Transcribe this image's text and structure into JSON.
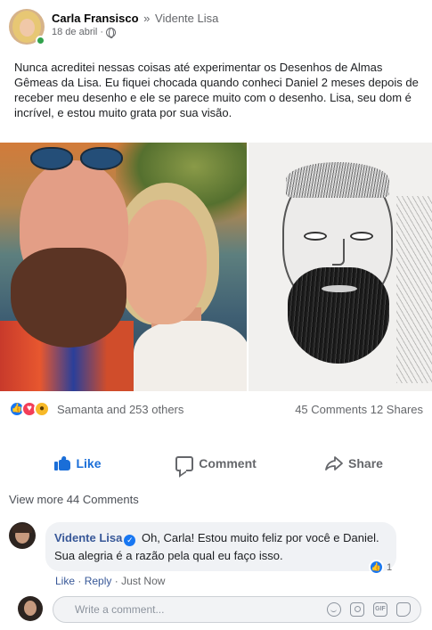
{
  "post": {
    "author": "Carla Fransisco",
    "arrow": "»",
    "page": "Vidente Lisa",
    "date": "18 de abril",
    "date_sep": "·",
    "privacy_icon": "globe-icon",
    "text": "Nunca acreditei nessas coisas até experimentar os Desenhos de Almas Gêmeas da Lisa. Eu fiquei chocada quando conheci Daniel 2 meses depois de receber meu desenho e ele se parece muito com o desenho. Lisa, seu dom é incrível, e estou muito grata por sua visão.",
    "reactions": {
      "icons": [
        "like-reaction-icon",
        "love-reaction-icon",
        "wow-reaction-icon"
      ],
      "summary": "Samanta and 253 others",
      "counts": "45 Comments 12 Shares"
    }
  },
  "actions": {
    "like": "Like",
    "comment": "Comment",
    "share": "Share"
  },
  "comments": {
    "view_more": "View more 44 Comments",
    "items": [
      {
        "name": "Vidente Lisa",
        "verified_icon": "verified-badge-icon",
        "text": "Oh, Carla! Estou muito feliz por você e Daniel. Sua alegria é a razão pela qual eu faço isso.",
        "like_count": "1",
        "like": "Like",
        "reply": "Reply",
        "time": "Just Now",
        "sep": "·"
      }
    ]
  },
  "composer": {
    "placeholder": "Write a comment..."
  },
  "colors": {
    "brand_blue": "#1877f2",
    "link_blue": "#385898",
    "muted_text": "#65676b",
    "online_green": "#31a24c",
    "love_red": "#f33e58",
    "wow_yellow": "#f7b928"
  }
}
